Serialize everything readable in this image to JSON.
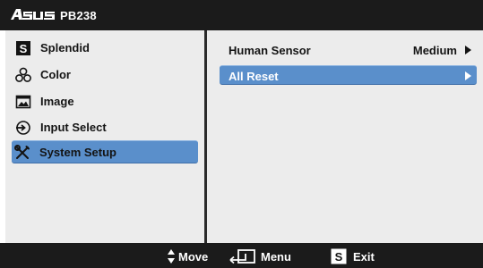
{
  "header": {
    "brand": "ASUS",
    "model": "PB238"
  },
  "main_menu": {
    "items": [
      {
        "label": "Splendid",
        "icon": "splendid-s-icon",
        "selected": false
      },
      {
        "label": "Color",
        "icon": "color-circles-icon",
        "selected": false
      },
      {
        "label": "Image",
        "icon": "image-icon",
        "selected": false
      },
      {
        "label": "Input Select",
        "icon": "input-select-icon",
        "selected": false
      },
      {
        "label": "System Setup",
        "icon": "wrench-screwdriver-icon",
        "selected": true
      }
    ]
  },
  "submenu": {
    "items": [
      {
        "label": "Human Sensor",
        "value": "Medium",
        "has_arrow": true,
        "selected": false
      },
      {
        "label": "All Reset",
        "value": "",
        "has_arrow": true,
        "selected": true
      }
    ]
  },
  "footer": {
    "move_label": "Move",
    "menu_label": "Menu",
    "exit_label": "Exit",
    "exit_key": "S"
  },
  "colors": {
    "bar_background": "#1b1b1b",
    "panel_background": "#ececec",
    "highlight": "#5a8fcb"
  }
}
